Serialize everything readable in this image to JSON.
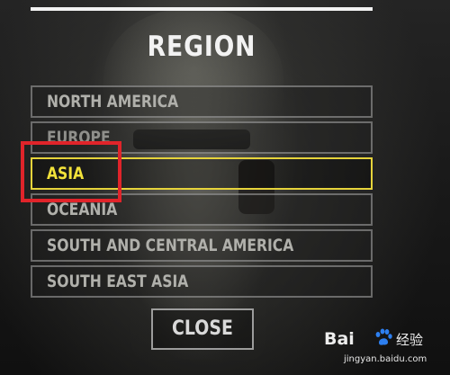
{
  "dialog": {
    "title": "REGION",
    "close_label": "CLOSE"
  },
  "regions": [
    {
      "label": "NORTH AMERICA",
      "selected": false
    },
    {
      "label": "EUROPE",
      "selected": false
    },
    {
      "label": "ASIA",
      "selected": true
    },
    {
      "label": "OCEANIA",
      "selected": false
    },
    {
      "label": "SOUTH AND CENTRAL AMERICA",
      "selected": false
    },
    {
      "label": "SOUTH EAST ASIA",
      "selected": false
    }
  ],
  "colors": {
    "selected_accent": "#e6d33b",
    "annotation": "#e0242a",
    "text": "#b0b0ab"
  },
  "watermark": {
    "logo_text_left": "Bai",
    "logo_text_right": "",
    "logo_cn": "经验",
    "url": "jingyan.baidu.com"
  }
}
